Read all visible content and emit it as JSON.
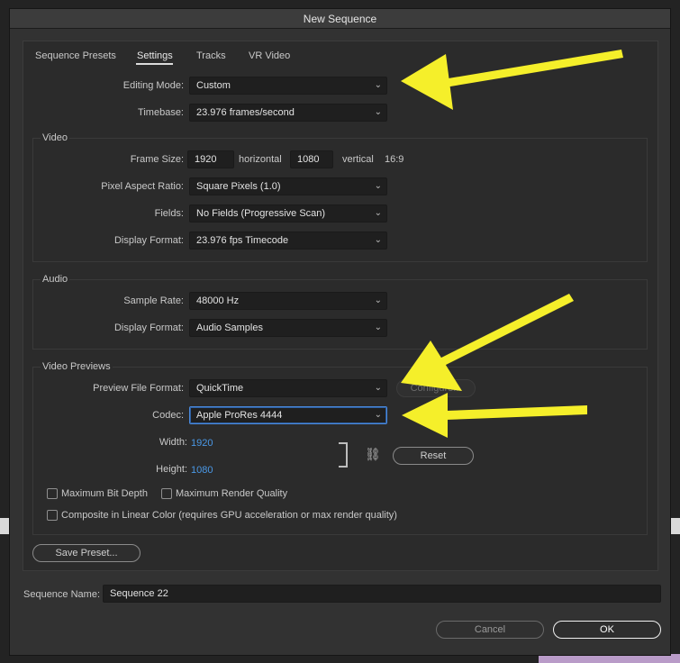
{
  "dialog": {
    "title": "New Sequence"
  },
  "tabs": [
    {
      "label": "Sequence Presets"
    },
    {
      "label": "Settings"
    },
    {
      "label": "Tracks"
    },
    {
      "label": "VR Video"
    }
  ],
  "settings": {
    "editing_mode": {
      "label": "Editing Mode:",
      "value": "Custom"
    },
    "timebase": {
      "label": "Timebase:",
      "value": "23.976  frames/second"
    }
  },
  "video": {
    "title": "Video",
    "frame_size_label": "Frame Size:",
    "width": "1920",
    "horizontal_label": "horizontal",
    "height": "1080",
    "vertical_label": "vertical",
    "aspect": "16:9",
    "pixel_aspect": {
      "label": "Pixel Aspect Ratio:",
      "value": "Square Pixels (1.0)"
    },
    "fields": {
      "label": "Fields:",
      "value": "No Fields (Progressive Scan)"
    },
    "display_format": {
      "label": "Display Format:",
      "value": "23.976 fps Timecode"
    }
  },
  "audio": {
    "title": "Audio",
    "sample_rate": {
      "label": "Sample Rate:",
      "value": "48000 Hz"
    },
    "display_format": {
      "label": "Display Format:",
      "value": "Audio Samples"
    }
  },
  "previews": {
    "title": "Video Previews",
    "file_format": {
      "label": "Preview File Format:",
      "value": "QuickTime"
    },
    "configure_label": "Configure...",
    "codec": {
      "label": "Codec:",
      "value": "Apple ProRes 4444"
    },
    "width_label": "Width:",
    "width": "1920",
    "height_label": "Height:",
    "height": "1080",
    "reset_label": "Reset",
    "max_bit_depth": "Maximum Bit Depth",
    "max_render_quality": "Maximum Render Quality",
    "composite_linear": "Composite in Linear Color (requires GPU acceleration or max render quality)"
  },
  "save_preset_label": "Save Preset...",
  "sequence_name": {
    "label": "Sequence Name:",
    "value": "Sequence 22"
  },
  "cancel_label": "Cancel",
  "ok_label": "OK",
  "colors": {
    "accent_blue": "#4a98e6",
    "arrow_yellow": "#f5ef2a",
    "dialog_bg": "#323232"
  }
}
